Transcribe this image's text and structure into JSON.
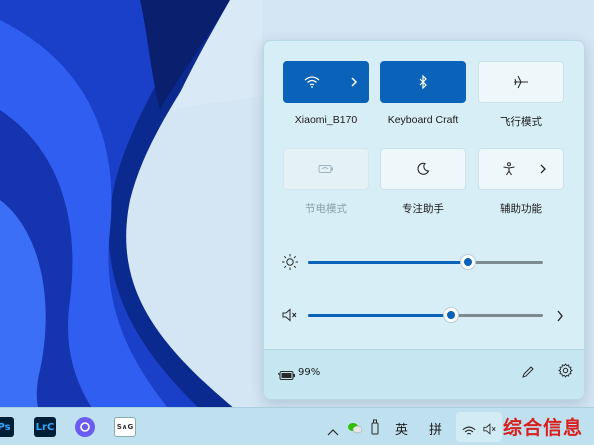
{
  "quick_settings": {
    "tiles_row1": [
      {
        "label": "Xiaomi_B170",
        "state": "on",
        "icon": "wifi-icon"
      },
      {
        "label": "Keyboard Craft",
        "state": "on",
        "icon": "bluetooth-icon"
      },
      {
        "label": "飞行模式",
        "state": "off",
        "icon": "airplane-icon"
      }
    ],
    "tiles_row2": [
      {
        "label": "节电模式",
        "state": "disabled",
        "icon": "battery-saver-icon"
      },
      {
        "label": "专注助手",
        "state": "off",
        "icon": "moon-icon"
      },
      {
        "label": "辅助功能",
        "state": "off",
        "icon": "accessibility-icon"
      }
    ],
    "brightness": {
      "icon": "sun-icon",
      "level_percent": 68
    },
    "volume": {
      "icon": "speaker-muted-icon",
      "level_percent": 61
    },
    "battery_text": "99%"
  },
  "taskbar": {
    "apps": [
      {
        "name": "Ps",
        "icon": "photoshop-icon"
      },
      {
        "name": "LrC",
        "icon": "lightroom-classic-icon"
      },
      {
        "name": "",
        "icon": "copilot-icon"
      },
      {
        "name": "S∧G",
        "icon": "snipaste-icon"
      }
    ],
    "ime_lang": "英",
    "ime_mode": "拼"
  },
  "watermark": "综合信息",
  "colors": {
    "accent": "#0a63b8",
    "panel_bg": "#d7eef6",
    "taskbar_bg": "#bfe1ef",
    "watermark": "#d8201e"
  }
}
